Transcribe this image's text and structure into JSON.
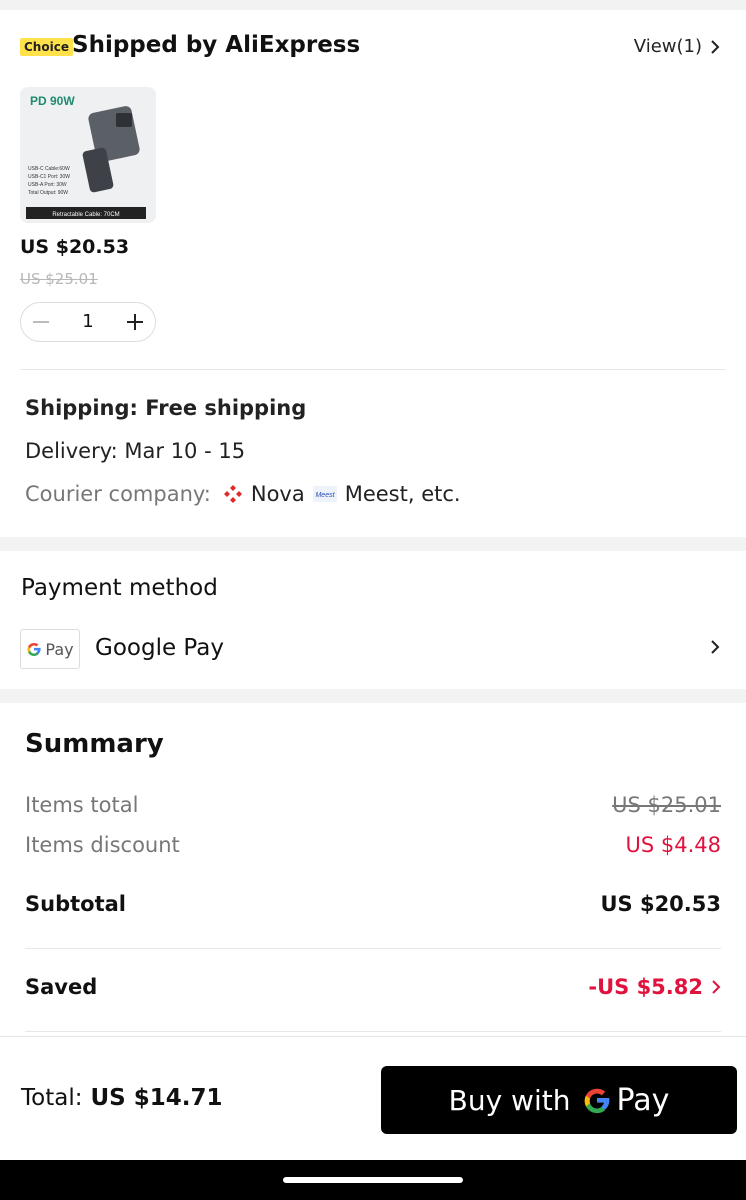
{
  "shipped": {
    "badge": "Choice",
    "title": "Shipped by AliExpress",
    "view_link": "View(1)"
  },
  "product": {
    "image_label_top": "PD 90W",
    "image_specs": [
      "USB-C Cable:60W",
      "USB-C1 Port: 30W",
      "USB-A Port: 30W",
      "Total Output: 90W"
    ],
    "image_label_bottom": "Retractable Cable: 70CM",
    "price": "US $20.53",
    "original_price": "US $25.01",
    "quantity": "1"
  },
  "shipping": {
    "free": "Shipping: Free shipping",
    "delivery": "Delivery: Mar 10 - 15",
    "courier_label": "Courier company:",
    "courier_1": "Nova",
    "courier_2_logo": "Meest",
    "courier_2": "Meest, etc."
  },
  "payment": {
    "title": "Payment method",
    "logo_text": "Pay",
    "name": "Google Pay"
  },
  "summary": {
    "title": "Summary",
    "items_total_label": "Items total",
    "items_total_value": "US $25.01",
    "discount_label": "Items discount",
    "discount_value": "US $4.48",
    "subtotal_label": "Subtotal",
    "subtotal_value": "US $20.53",
    "saved_label": "Saved",
    "saved_value": "-US $5.82"
  },
  "footer": {
    "total_label": "Total:",
    "total_value": "US $14.71",
    "buy_label": "Buy with",
    "buy_pay": "Pay"
  },
  "colors": {
    "accent_red": "#e0123e",
    "choice_yellow": "#ffe14a",
    "google_blue": "#4285F4",
    "google_red": "#EA4335",
    "google_yellow": "#FBBC05",
    "google_green": "#34A853"
  }
}
